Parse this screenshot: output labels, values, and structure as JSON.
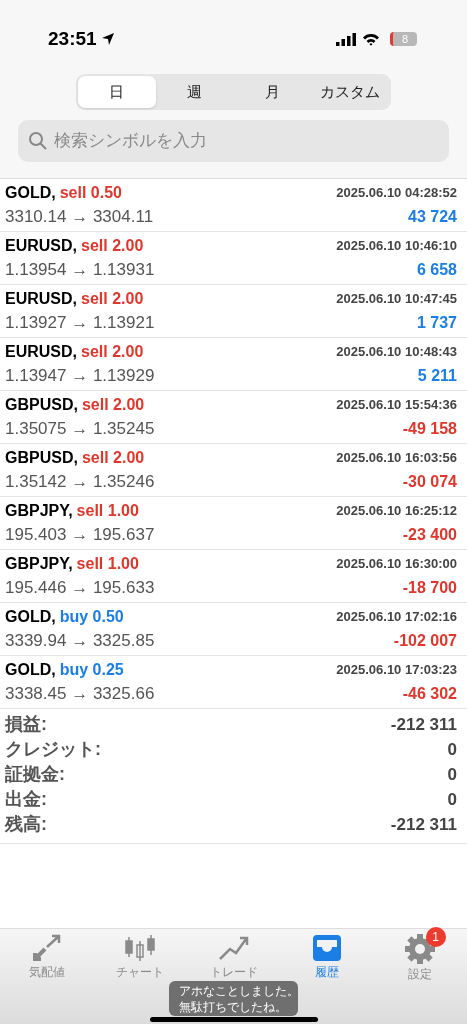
{
  "status_bar": {
    "time": "23:51",
    "battery": "8"
  },
  "period_tabs": [
    {
      "label": "日",
      "selected": true
    },
    {
      "label": "週",
      "selected": false
    },
    {
      "label": "月",
      "selected": false
    },
    {
      "label": "カスタム",
      "selected": false
    }
  ],
  "search": {
    "placeholder": "検索シンボルを入力"
  },
  "trades": [
    {
      "symbol": "GOLD,",
      "kind": "sell",
      "volume": "sell 0.50",
      "time": "2025.06.10 04:28:52",
      "prices": "3310.14 → 3304.11",
      "profit": "43 724",
      "loss": false
    },
    {
      "symbol": "EURUSD,",
      "kind": "sell",
      "volume": "sell 2.00",
      "time": "2025.06.10 10:46:10",
      "prices": "1.13954 → 1.13931",
      "profit": "6 658",
      "loss": false
    },
    {
      "symbol": "EURUSD,",
      "kind": "sell",
      "volume": "sell 2.00",
      "time": "2025.06.10 10:47:45",
      "prices": "1.13927 → 1.13921",
      "profit": "1 737",
      "loss": false
    },
    {
      "symbol": "EURUSD,",
      "kind": "sell",
      "volume": "sell 2.00",
      "time": "2025.06.10 10:48:43",
      "prices": "1.13947 → 1.13929",
      "profit": "5 211",
      "loss": false
    },
    {
      "symbol": "GBPUSD,",
      "kind": "sell",
      "volume": "sell 2.00",
      "time": "2025.06.10 15:54:36",
      "prices": "1.35075 → 1.35245",
      "profit": "-49 158",
      "loss": true
    },
    {
      "symbol": "GBPUSD,",
      "kind": "sell",
      "volume": "sell 2.00",
      "time": "2025.06.10 16:03:56",
      "prices": "1.35142 → 1.35246",
      "profit": "-30 074",
      "loss": true
    },
    {
      "symbol": "GBPJPY,",
      "kind": "sell",
      "volume": "sell 1.00",
      "time": "2025.06.10 16:25:12",
      "prices": "195.403 → 195.637",
      "profit": "-23 400",
      "loss": true
    },
    {
      "symbol": "GBPJPY,",
      "kind": "sell",
      "volume": "sell 1.00",
      "time": "2025.06.10 16:30:00",
      "prices": "195.446 → 195.633",
      "profit": "-18 700",
      "loss": true
    },
    {
      "symbol": "GOLD,",
      "kind": "buy",
      "volume": "buy 0.50",
      "time": "2025.06.10 17:02:16",
      "prices": "3339.94 → 3325.85",
      "profit": "-102 007",
      "loss": true
    },
    {
      "symbol": "GOLD,",
      "kind": "buy",
      "volume": "buy 0.25",
      "time": "2025.06.10 17:03:23",
      "prices": "3338.45 → 3325.66",
      "profit": "-46 302",
      "loss": true
    }
  ],
  "summary": [
    {
      "label": "損益:",
      "value": "-212 311"
    },
    {
      "label": "クレジット:",
      "value": "0"
    },
    {
      "label": "証拠金:",
      "value": "0"
    },
    {
      "label": "出金:",
      "value": "0"
    },
    {
      "label": "残高:",
      "value": "-212 311"
    }
  ],
  "tab_bar": [
    {
      "kind": "quotes",
      "label": "気配値",
      "selected": false
    },
    {
      "kind": "chart",
      "label": "チャート",
      "selected": false
    },
    {
      "kind": "trade",
      "label": "トレード",
      "selected": false
    },
    {
      "kind": "history",
      "label": "履歴",
      "selected": true
    },
    {
      "kind": "settings",
      "label": "設定",
      "selected": false,
      "badge": "1"
    }
  ],
  "toast": [
    "アホなことしました。",
    "無駄打ちでしたね。"
  ]
}
